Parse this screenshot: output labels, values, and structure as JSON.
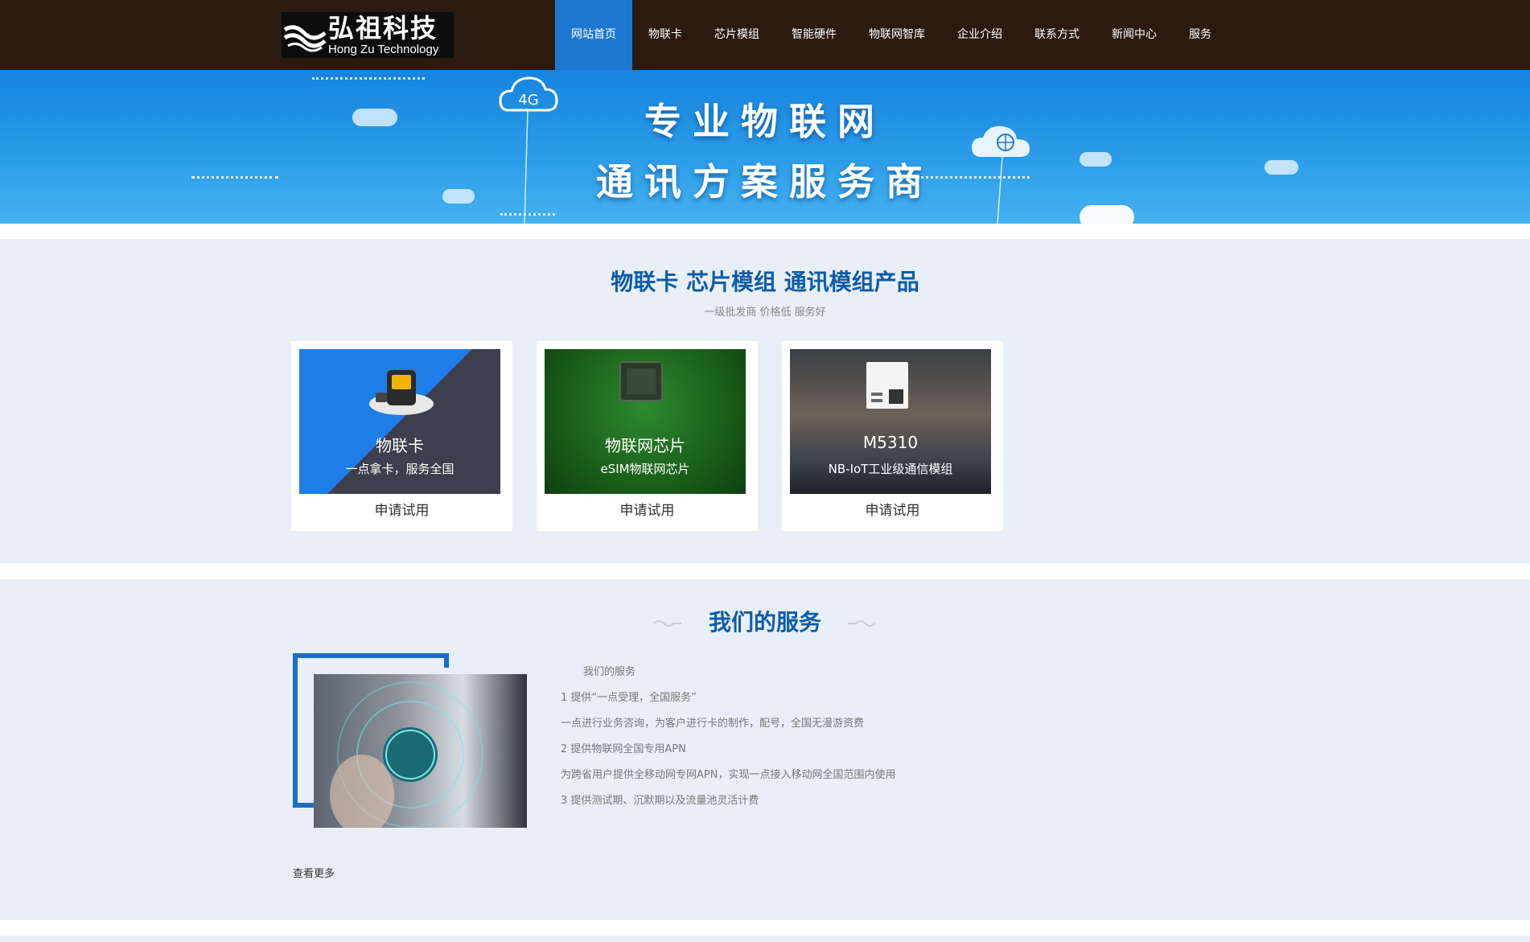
{
  "header": {
    "logo_cn": "弘祖科技",
    "logo_en": "Hong Zu Technology",
    "nav": [
      {
        "label": "网站首页",
        "active": true
      },
      {
        "label": "物联卡",
        "active": false
      },
      {
        "label": "芯片模组",
        "active": false
      },
      {
        "label": "智能硬件",
        "active": false
      },
      {
        "label": "物联网智库",
        "active": false
      },
      {
        "label": "企业介绍",
        "active": false
      },
      {
        "label": "联系方式",
        "active": false
      },
      {
        "label": "新闻中心",
        "active": false
      },
      {
        "label": "服务",
        "active": false
      }
    ]
  },
  "banner": {
    "line1": "专业物联网",
    "line2": "通讯方案服务商",
    "cloud_label": "4G"
  },
  "products": {
    "title": "物联卡 芯片模组 通讯模组产品",
    "subtitle": "一级批发商 价格低 服务好",
    "cards": [
      {
        "name": "物联卡",
        "desc": "一点拿卡，服务全国",
        "button": "申请试用"
      },
      {
        "name": "物联网芯片",
        "desc": "eSIM物联网芯片",
        "button": "申请试用"
      },
      {
        "name": "M5310",
        "desc": "NB-IoT工业级通信模组",
        "button": "申请试用"
      }
    ]
  },
  "services": {
    "title": "我们的服务",
    "lines": [
      "我们的服务",
      "1 提供“一点受理，全国服务”",
      "一点进行业务咨询，为客户进行卡的制作，配号，全国无漫游资费",
      "2 提供物联网全国专用APN",
      "为跨省用户提供全移动网专网APN，实现一点接入移动网全国范围内使用",
      "3 提供测试期、沉默期以及流量池灵活计费"
    ],
    "more": "查看更多"
  },
  "colors": {
    "header_bg": "#2b1a0f",
    "accent": "#1e78d2",
    "title_blue": "#0d5ca8",
    "section_bg": "#e8eff8"
  }
}
